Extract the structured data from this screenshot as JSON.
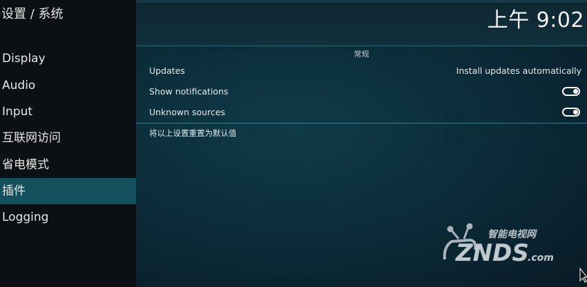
{
  "breadcrumb": "设置 / 系统",
  "clock": "上午 9:02",
  "sidebar": {
    "items": [
      {
        "label": "Display"
      },
      {
        "label": "Audio"
      },
      {
        "label": "Input"
      },
      {
        "label": "互联网访问"
      },
      {
        "label": "省电模式"
      },
      {
        "label": "插件"
      },
      {
        "label": "Logging"
      }
    ],
    "active_index": 5
  },
  "content": {
    "section_title": "常规",
    "rows": [
      {
        "label": "Updates",
        "value": "Install updates automatically"
      },
      {
        "label": "Show notifications",
        "toggle": true
      },
      {
        "label": "Unknown sources",
        "toggle": true
      }
    ],
    "reset_label": "将以上设置重置为默认值"
  },
  "watermark": {
    "top": "智能电视网",
    "main": "ZNDS",
    "suffix": ".com"
  },
  "colors": {
    "active_item": "#12505e",
    "sidebar_bg": "#0c1014",
    "content_bg": "#0c2d3a",
    "divider": "#3c7a88"
  }
}
